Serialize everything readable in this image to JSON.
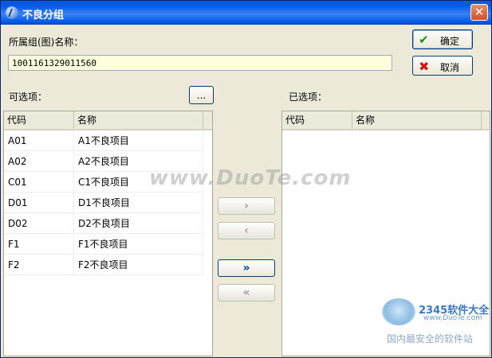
{
  "window": {
    "title": "不良分组",
    "close_glyph": "✕"
  },
  "form": {
    "group_label": "所属组(图)名称：",
    "group_value": "1001161329011560",
    "ok_label": "确定",
    "cancel_label": "取消",
    "available_label": "可选项：",
    "browse_label": "...",
    "selected_label": "已选项："
  },
  "available": {
    "columns": [
      "代码",
      "名称"
    ],
    "rows": [
      {
        "code": "A01",
        "name": "A1不良项目"
      },
      {
        "code": "A02",
        "name": "A2不良项目"
      },
      {
        "code": "C01",
        "name": "C1不良项目"
      },
      {
        "code": "D01",
        "name": "D1不良项目"
      },
      {
        "code": "D02",
        "name": "D2不良项目"
      },
      {
        "code": "F1",
        "name": "F1不良项目"
      },
      {
        "code": "F2",
        "name": "F2不良项目"
      }
    ]
  },
  "selected": {
    "columns": [
      "代码",
      "名称"
    ],
    "rows": []
  },
  "move_buttons": {
    "add_one": "›",
    "remove_one": "‹",
    "add_all": "»",
    "remove_all": "«"
  },
  "icons": {
    "ok": "check-icon",
    "cancel": "cross-icon",
    "app": "app-icon"
  },
  "watermark": {
    "text": "www.DuoTe.com",
    "brand": "2345软件大全",
    "url": "www.DuoTe.com",
    "slogan": "国内最安全的软件站"
  }
}
